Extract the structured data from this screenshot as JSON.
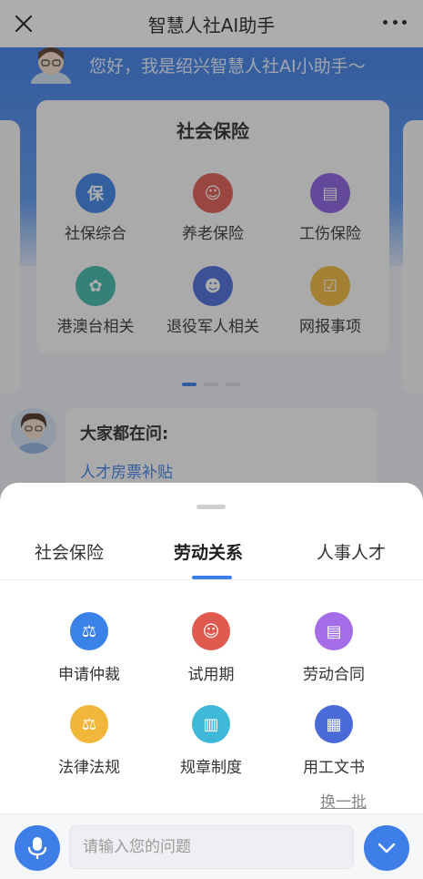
{
  "topbar": {
    "title": "智慧人社AI助手"
  },
  "greeting": "您好，我是绍兴智慧人社AI小助手～",
  "social_insurance_card": {
    "title": "社会保险",
    "items": [
      {
        "label": "社保综合",
        "icon": "shield-icon",
        "glyph": "保",
        "color": "#3b82e8"
      },
      {
        "label": "养老保险",
        "icon": "elder-icon",
        "glyph": "☺",
        "color": "#e05a4f"
      },
      {
        "label": "工伤保险",
        "icon": "document-icon",
        "glyph": "▤",
        "color": "#8a5ce0"
      },
      {
        "label": "港澳台相关",
        "icon": "bauhinia-icon",
        "glyph": "✿",
        "color": "#3fb9a8"
      },
      {
        "label": "退役军人相关",
        "icon": "soldier-icon",
        "glyph": "☻",
        "color": "#4a6ad8"
      },
      {
        "label": "网报事项",
        "icon": "clipboard-icon",
        "glyph": "☑",
        "color": "#f0b73a"
      }
    ]
  },
  "faq": {
    "title": "大家都在问:",
    "question": "人才房票补贴"
  },
  "sheet": {
    "tabs": [
      "社会保险",
      "劳动关系",
      "人事人才"
    ],
    "active_tab": "劳动关系",
    "items": [
      {
        "label": "申请仲裁",
        "icon": "gavel-icon",
        "glyph": "⚖",
        "color": "#3b82e8"
      },
      {
        "label": "试用期",
        "icon": "user-badge-icon",
        "glyph": "☺",
        "color": "#e05a4f"
      },
      {
        "label": "劳动合同",
        "icon": "contract-icon",
        "glyph": "▤",
        "color": "#a56ce8"
      },
      {
        "label": "法律法规",
        "icon": "scales-icon",
        "glyph": "⚖",
        "color": "#f0b73a"
      },
      {
        "label": "规章制度",
        "icon": "rules-icon",
        "glyph": "▥",
        "color": "#3fb9d8"
      },
      {
        "label": "用工文书",
        "icon": "file-icon",
        "glyph": "▦",
        "color": "#4a6ad8"
      }
    ],
    "swap_label": "换一批"
  },
  "input": {
    "placeholder": "请输入您的问题",
    "value": ""
  }
}
